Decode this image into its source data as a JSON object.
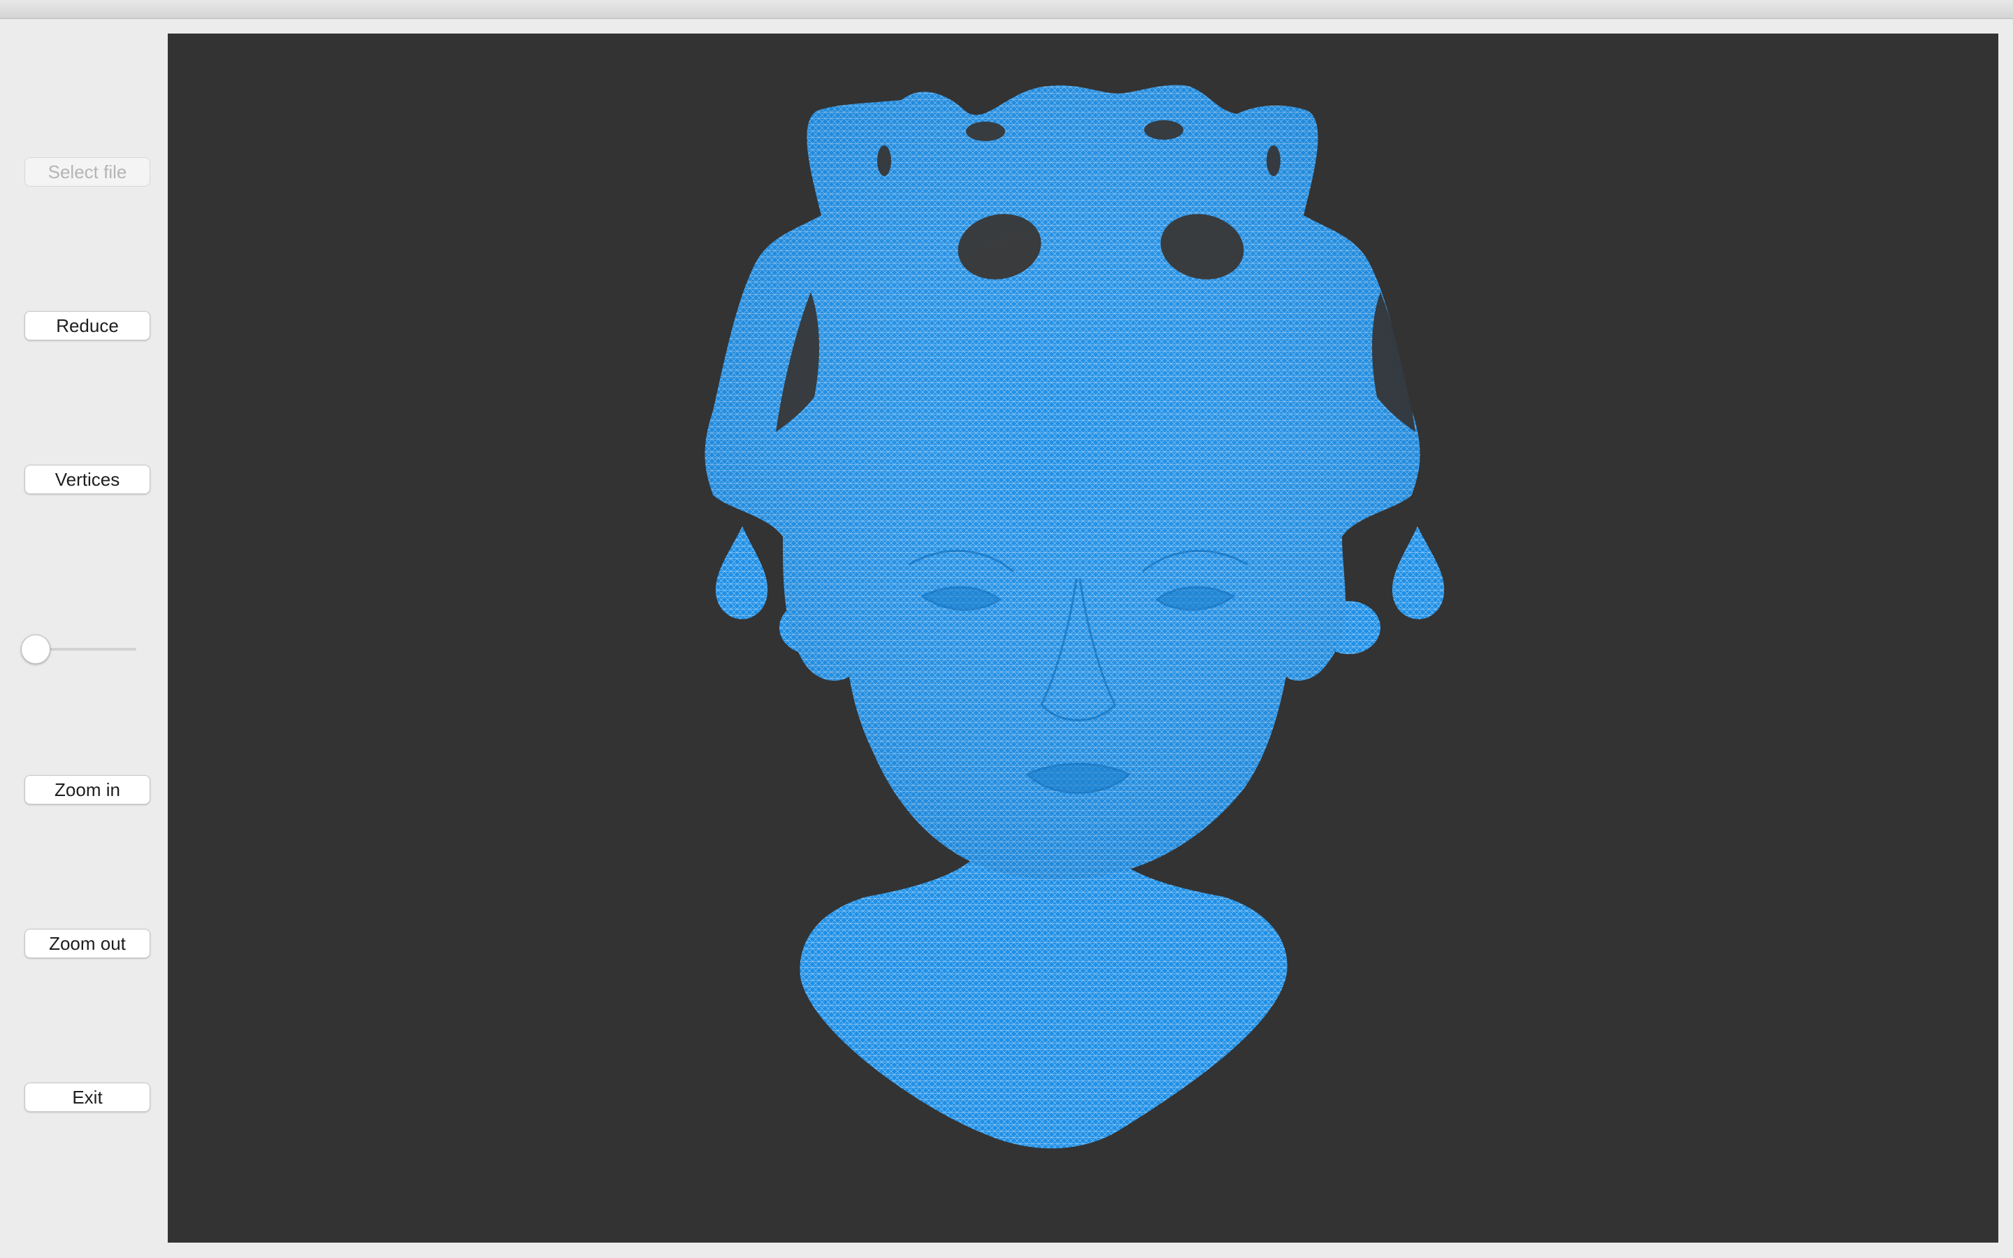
{
  "sidebar": {
    "select_file_label": "Select file",
    "reduce_label": "Reduce",
    "vertices_label": "Vertices",
    "zoom_in_label": "Zoom in",
    "zoom_out_label": "Zoom out",
    "exit_label": "Exit",
    "slider_value": 0
  },
  "viewport": {
    "background_color": "#333333",
    "mesh_color": "#1e8fe6",
    "wire_color": "#ffffff"
  }
}
